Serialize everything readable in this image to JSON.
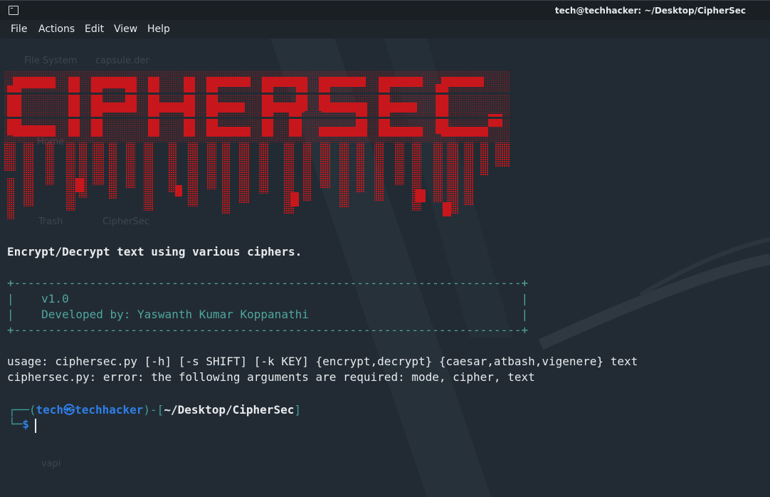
{
  "window": {
    "title": "tech@techhacker: ~/Desktop/CipherSec"
  },
  "menu": {
    "items": [
      "File",
      "Actions",
      "Edit",
      "View",
      "Help"
    ]
  },
  "desktop_icons": {
    "file_system": "File System",
    "capsule": "capsule.der",
    "home": "Home",
    "trash": "Trash",
    "ciphersec": "CipherSec",
    "vapi": "vapi"
  },
  "banner": {
    "text": "CIPHERSEC",
    "color": "#c8171c"
  },
  "output": {
    "tagline": "Encrypt/Decrypt text using various ciphers.",
    "box_top": "+--------------------------------------------------------------------------+",
    "box_line1": "|    v1.0                                                                  |",
    "box_line2": "|    Developed by: Yaswanth Kumar Koppanathi                               |",
    "box_bottom": "+--------------------------------------------------------------------------+",
    "usage": "usage: ciphersec.py [-h] [-s SHIFT] [-k KEY] {encrypt,decrypt} {caesar,atbash,vigenere} text",
    "error": "ciphersec.py: error: the following arguments are required: mode, cipher, text"
  },
  "prompt": {
    "corner_top": "┌──(",
    "user": "tech",
    "at_symbol": "㉿",
    "host": "techhacker",
    "mid": ")-[",
    "path": "~/Desktop/CipherSec",
    "end": "]",
    "corner_bottom": "└─",
    "dollar": "$"
  },
  "colors": {
    "banner_red": "#c8171c",
    "box_teal": "#4fa6a0",
    "prompt_green": "#3e9fa0",
    "prompt_blue": "#2f7fe8",
    "text": "#e8ebee"
  }
}
